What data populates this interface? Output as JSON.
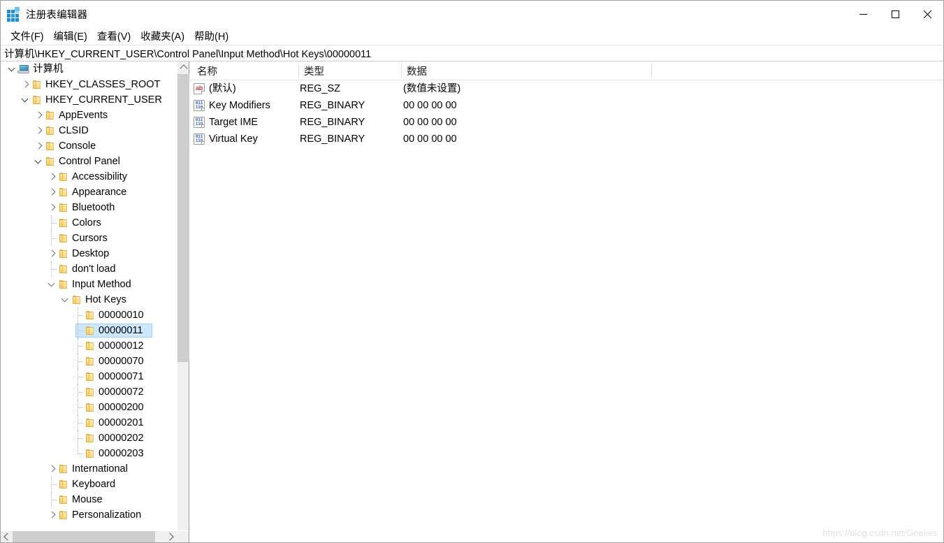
{
  "window": {
    "title": "注册表编辑器",
    "app_icon": "registry-grid-icon",
    "controls": {
      "minimize": "—",
      "maximize": "☐",
      "close": "✕"
    }
  },
  "menubar": {
    "items": [
      {
        "label": "文件(F)",
        "name": "menu-file"
      },
      {
        "label": "编辑(E)",
        "name": "menu-edit"
      },
      {
        "label": "查看(V)",
        "name": "menu-view"
      },
      {
        "label": "收藏夹(A)",
        "name": "menu-favorites"
      },
      {
        "label": "帮助(H)",
        "name": "menu-help"
      }
    ]
  },
  "address": {
    "path": "计算机\\HKEY_CURRENT_USER\\Control Panel\\Input Method\\Hot Keys\\00000011"
  },
  "tree": {
    "nodes": [
      {
        "label": "计算机",
        "depth": 0,
        "icon": "computer-icon",
        "state": "expanded",
        "selected": false
      },
      {
        "label": "HKEY_CLASSES_ROOT",
        "depth": 1,
        "icon": "folder-icon",
        "state": "collapsed",
        "selected": false
      },
      {
        "label": "HKEY_CURRENT_USER",
        "depth": 1,
        "icon": "folder-icon",
        "state": "expanded",
        "selected": false
      },
      {
        "label": "AppEvents",
        "depth": 2,
        "icon": "folder-icon",
        "state": "collapsed",
        "selected": false
      },
      {
        "label": "CLSID",
        "depth": 2,
        "icon": "folder-icon",
        "state": "collapsed",
        "selected": false
      },
      {
        "label": "Console",
        "depth": 2,
        "icon": "folder-icon",
        "state": "collapsed",
        "selected": false
      },
      {
        "label": "Control Panel",
        "depth": 2,
        "icon": "folder-icon",
        "state": "expanded",
        "selected": false
      },
      {
        "label": "Accessibility",
        "depth": 3,
        "icon": "folder-icon",
        "state": "collapsed",
        "selected": false
      },
      {
        "label": "Appearance",
        "depth": 3,
        "icon": "folder-icon",
        "state": "collapsed",
        "selected": false
      },
      {
        "label": "Bluetooth",
        "depth": 3,
        "icon": "folder-icon",
        "state": "collapsed",
        "selected": false
      },
      {
        "label": "Colors",
        "depth": 3,
        "icon": "folder-icon",
        "state": "leaf",
        "selected": false
      },
      {
        "label": "Cursors",
        "depth": 3,
        "icon": "folder-icon",
        "state": "leaf",
        "selected": false
      },
      {
        "label": "Desktop",
        "depth": 3,
        "icon": "folder-icon",
        "state": "collapsed",
        "selected": false
      },
      {
        "label": "don't load",
        "depth": 3,
        "icon": "folder-icon",
        "state": "leaf",
        "selected": false
      },
      {
        "label": "Input Method",
        "depth": 3,
        "icon": "folder-icon",
        "state": "expanded",
        "selected": false
      },
      {
        "label": "Hot Keys",
        "depth": 4,
        "icon": "folder-icon",
        "state": "expanded",
        "selected": false
      },
      {
        "label": "00000010",
        "depth": 5,
        "icon": "folder-icon",
        "state": "leaf",
        "selected": false
      },
      {
        "label": "00000011",
        "depth": 5,
        "icon": "folder-icon",
        "state": "leaf",
        "selected": true
      },
      {
        "label": "00000012",
        "depth": 5,
        "icon": "folder-icon",
        "state": "leaf",
        "selected": false
      },
      {
        "label": "00000070",
        "depth": 5,
        "icon": "folder-icon",
        "state": "leaf",
        "selected": false
      },
      {
        "label": "00000071",
        "depth": 5,
        "icon": "folder-icon",
        "state": "leaf",
        "selected": false
      },
      {
        "label": "00000072",
        "depth": 5,
        "icon": "folder-icon",
        "state": "leaf",
        "selected": false
      },
      {
        "label": "00000200",
        "depth": 5,
        "icon": "folder-icon",
        "state": "leaf",
        "selected": false
      },
      {
        "label": "00000201",
        "depth": 5,
        "icon": "folder-icon",
        "state": "leaf",
        "selected": false
      },
      {
        "label": "00000202",
        "depth": 5,
        "icon": "folder-icon",
        "state": "leaf",
        "selected": false
      },
      {
        "label": "00000203",
        "depth": 5,
        "icon": "folder-icon",
        "state": "last",
        "selected": false
      },
      {
        "label": "International",
        "depth": 3,
        "icon": "folder-icon",
        "state": "collapsed",
        "selected": false
      },
      {
        "label": "Keyboard",
        "depth": 3,
        "icon": "folder-icon",
        "state": "leaf",
        "selected": false
      },
      {
        "label": "Mouse",
        "depth": 3,
        "icon": "folder-icon",
        "state": "leaf",
        "selected": false
      },
      {
        "label": "Personalization",
        "depth": 3,
        "icon": "folder-icon",
        "state": "collapsed",
        "selected": false
      }
    ]
  },
  "values": {
    "columns": [
      "名称",
      "类型",
      "数据"
    ],
    "rows": [
      {
        "name": "(默认)",
        "type": "REG_SZ",
        "data": "(数值未设置)",
        "icon": "string-value-icon"
      },
      {
        "name": "Key Modifiers",
        "type": "REG_BINARY",
        "data": "00 00 00 00",
        "icon": "binary-value-icon"
      },
      {
        "name": "Target IME",
        "type": "REG_BINARY",
        "data": "00 00 00 00",
        "icon": "binary-value-icon"
      },
      {
        "name": "Virtual Key",
        "type": "REG_BINARY",
        "data": "00 00 00 00",
        "icon": "binary-value-icon"
      }
    ]
  },
  "watermark": {
    "text": "https://blog.csdn.net/Geekes"
  },
  "colors": {
    "selection_bg": "#cce8ff",
    "selection_border": "#99d1ff",
    "folder": "#fbd976",
    "string_icon": "#c0392b",
    "binary_icon": "#2a56c6",
    "scrollbar_thumb": "#cdcdcd"
  }
}
